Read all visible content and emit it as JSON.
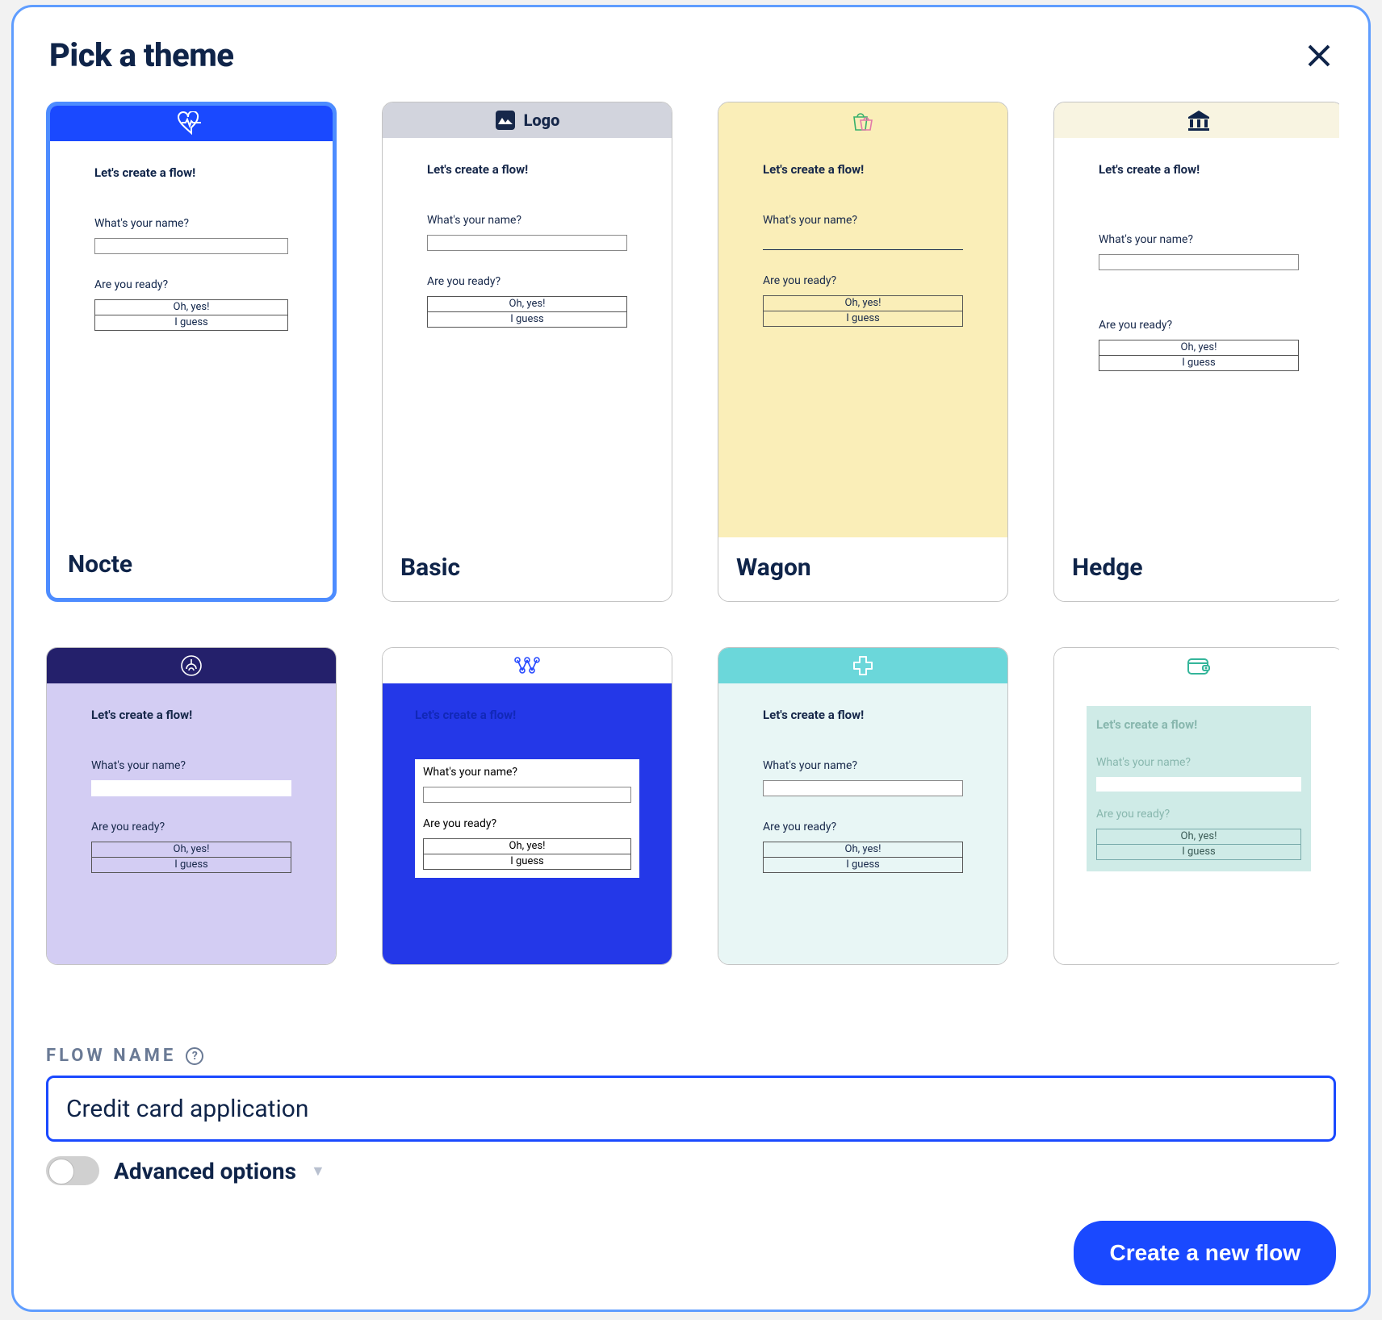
{
  "modal": {
    "title": "Pick a theme",
    "close_icon": "close"
  },
  "preview_common": {
    "heading": "Let's create a flow!",
    "q1": "What's your name?",
    "q2": "Are you ready?",
    "a1": "Oh, yes!",
    "a2": "I guess"
  },
  "themes": [
    {
      "id": "nocte",
      "name": "Nocte",
      "selected": true,
      "header_bg": "#1a49ff",
      "icon": "heartbeat",
      "icon_color": "#ffffff",
      "body_bg": "#ffffff",
      "text_color": "#0f2449",
      "input_style": "box"
    },
    {
      "id": "basic",
      "name": "Basic",
      "selected": false,
      "header_bg": "#d2d4dd",
      "icon": "logo-badge",
      "icon_color": "#17284a",
      "logo_text": "Logo",
      "body_bg": "#ffffff",
      "text_color": "#17284a",
      "input_style": "box"
    },
    {
      "id": "wagon",
      "name": "Wagon",
      "selected": false,
      "header_bg": "#faeeb8",
      "icon": "shopping-bag",
      "icon_color": "#36b06a",
      "body_bg": "#faeeb8",
      "text_color": "#17284a",
      "input_style": "underline"
    },
    {
      "id": "hedge",
      "name": "Hedge",
      "selected": false,
      "header_bg": "#f8f4e1",
      "icon": "bank",
      "icon_color": "#0f2449",
      "body_bg": "#ffffff",
      "text_color": "#17284a",
      "input_style": "box",
      "variant": "hedge"
    },
    {
      "id": "row2a",
      "name": "",
      "selected": false,
      "header_bg": "#24206b",
      "icon": "fingerprint",
      "icon_color": "#ffffff",
      "body_bg": "#d3cdf3",
      "text_color": "#17284a",
      "input_style": "box-white"
    },
    {
      "id": "row2b",
      "name": "",
      "selected": false,
      "header_bg": "#ffffff",
      "icon": "nodes",
      "icon_color": "#2649ff",
      "body_bg": "#2438e8",
      "text_color": "#17284a",
      "variant": "royal"
    },
    {
      "id": "row2c",
      "name": "",
      "selected": false,
      "header_bg": "#6bd7da",
      "icon": "medical-cross",
      "icon_color": "#ffffff",
      "body_bg": "#e8f6f5",
      "text_color": "#17284a",
      "input_style": "box"
    },
    {
      "id": "row2d",
      "name": "",
      "selected": false,
      "header_bg": "#ffffff",
      "icon": "wallet",
      "icon_color": "#34b59a",
      "body_bg": "#ffffff",
      "text_color": "#88b7ae",
      "variant": "mint"
    }
  ],
  "form": {
    "label": "FLOW NAME",
    "help_icon": "help",
    "value": "Credit card application",
    "advanced_label": "Advanced options",
    "advanced_on": false,
    "submit": "Create a new flow"
  }
}
